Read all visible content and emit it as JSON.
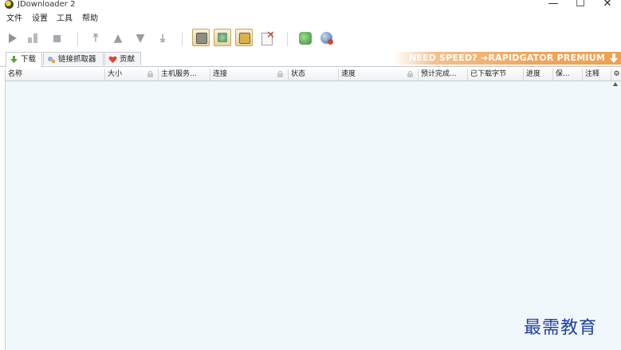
{
  "window": {
    "title": "JDownloader 2",
    "controls": {
      "minimize": "—",
      "maximize": "☐",
      "close": "✕"
    }
  },
  "menu": [
    "文件",
    "设置",
    "工具",
    "帮助"
  ],
  "toolbar": {
    "icons": [
      "start-downloads-icon",
      "pause-downloads-icon",
      "stop-downloads-icon",
      "move-top-icon",
      "move-up-icon",
      "move-down-icon",
      "move-bottom-icon",
      "clipboard-observer-icon",
      "auto-reconnect-icon",
      "premium-toggle-icon",
      "silent-mode-icon",
      "reconnect-icon",
      "update-icon"
    ]
  },
  "tabs": [
    {
      "label": "下载",
      "icon": "download-arrow-icon"
    },
    {
      "label": "链接抓取器",
      "icon": "link-grabber-icon"
    },
    {
      "label": "贡献",
      "icon": "heart-icon"
    }
  ],
  "banner": {
    "text": "NEED SPEED? ➔RAPIDGATOR PREMIUM"
  },
  "table": {
    "columns": [
      "名称",
      "大小",
      "主机服务...",
      "连接",
      "状态",
      "速度",
      "预计完成...",
      "已下载字节",
      "进度",
      "保...",
      "注释"
    ],
    "rows": []
  },
  "watermark": "最需教育",
  "colors": {
    "table_bg": "#f1f8fb",
    "banner": "#f2a558",
    "watermark": "#1f3ea3"
  }
}
